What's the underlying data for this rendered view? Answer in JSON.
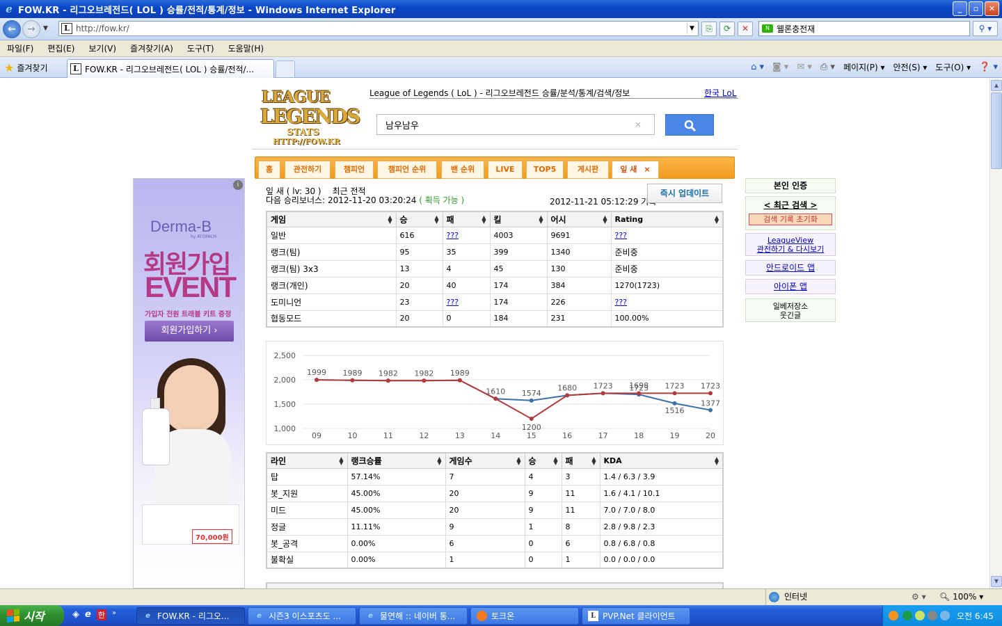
{
  "window": {
    "title": "FOW.KR - 리그오브레전드( LOL ) 승률/전적/통계/정보 - Windows Internet Explorer",
    "url": "http://fow.kr/",
    "search_value": "웰론충전재",
    "buttons": {
      "min": "_",
      "max": "▫",
      "close": "✕"
    }
  },
  "menu": [
    "파일(F)",
    "편집(E)",
    "보기(V)",
    "즐겨찾기(A)",
    "도구(T)",
    "도움말(H)"
  ],
  "tabs": {
    "favorites_label": "즐겨찾기",
    "active_tab": "FOW.KR - 리그오브레전드( LOL ) 승률/전적/...",
    "cmd": [
      "페이지(P) ▾",
      "안전(S) ▾",
      "도구(O) ▾"
    ]
  },
  "site": {
    "logo": {
      "line1": "LEAGUE",
      "line2": "LEGENDS",
      "of": "of",
      "line3": "STATS",
      "line4": "HTTP://FOW.KR"
    },
    "description": "League of Legends ( LoL ) - 리그오브레전드 승률/분석/통계/검색/정보",
    "korea_link": "한국 LoL",
    "search_value": "남우남우",
    "clear": "×",
    "nav": [
      {
        "label": "홈",
        "active": false
      },
      {
        "label": "관전하기",
        "active": false
      },
      {
        "label": "챔피언",
        "active": false
      },
      {
        "label": "챔피언 순위",
        "active": false
      },
      {
        "label": "밴 순위",
        "active": false
      },
      {
        "label": "LIVE",
        "active": false
      },
      {
        "label": "TOP5",
        "active": false
      },
      {
        "label": "게시판",
        "active": false
      },
      {
        "label": "잎 새",
        "active": true,
        "close": "×"
      }
    ]
  },
  "ad": {
    "info": "i",
    "brand": "Derma-B",
    "by": "by ATOPALM",
    "headline1": "회원가입",
    "headline2": "EVENT",
    "sub": "가입자 전원 트래블 키트 증정",
    "cta": "회원가입하기  ›",
    "price": "70,000원"
  },
  "sidebar": {
    "verify": "본인 인증",
    "recent": "< 최근 검색 >",
    "reset": "검색 기록 초기화",
    "leagueview_1": "LeagueView",
    "leagueview_2": "관전하기 & 다시보기",
    "android": "안드로이드 앱",
    "iphone": "아이폰 앱",
    "misc_1": "일베저장소",
    "misc_2": "웃긴글"
  },
  "summoner": {
    "name_line": "잎 새 ( lv: 30 )",
    "recent_label": "최근 전적",
    "bonus_label": "다음 승리보너스: 2012-11-20 03:20:24",
    "bonus_status": "( 획득 가능 )",
    "record_time": "2012-11-21 05:12:29 기록",
    "update_button": "즉시 업데이트"
  },
  "games_table": {
    "headers": [
      "게임",
      "승",
      "패",
      "킬",
      "어시",
      "Rating"
    ],
    "rows": [
      [
        "일반",
        "616",
        "???",
        "4003",
        "9691",
        "???"
      ],
      [
        "랭크(팀)",
        "95",
        "35",
        "399",
        "1340",
        "준비중"
      ],
      [
        "랭크(팀) 3x3",
        "13",
        "4",
        "45",
        "130",
        "준비중"
      ],
      [
        "랭크(개인)",
        "20",
        "40",
        "174",
        "384",
        "1270(1723)"
      ],
      [
        "도미니언",
        "23",
        "???",
        "174",
        "226",
        "???"
      ],
      [
        "협동모드",
        "20",
        "0",
        "184",
        "231",
        "100.00%"
      ]
    ]
  },
  "chart_data": {
    "type": "line",
    "x": [
      "09",
      "10",
      "11",
      "12",
      "13",
      "14",
      "15",
      "16",
      "17",
      "18",
      "19",
      "20"
    ],
    "ylim": [
      1000,
      2500
    ],
    "yticks": [
      "1,000",
      "1,500",
      "2,000",
      "2,500"
    ],
    "grid": true,
    "series": [
      {
        "color": "#b23a3a",
        "values": [
          1999,
          1989,
          1982,
          1982,
          1989,
          1610,
          1200,
          1680,
          1723,
          1723,
          1723,
          1723
        ],
        "labels": [
          "1999",
          "1989",
          "1982",
          "1982",
          "1989",
          "1610",
          "1200",
          "1680",
          "1723",
          "1723",
          "1723",
          "1723"
        ]
      },
      {
        "color": "#3b6fa8",
        "values": [
          1999,
          1989,
          1982,
          1982,
          1989,
          1610,
          1574,
          1680,
          1723,
          1698,
          1516,
          1377
        ],
        "labels": [
          "",
          "",
          "",
          "",
          "",
          "",
          "1574",
          "",
          "",
          "1698",
          "1516",
          "1377"
        ]
      }
    ]
  },
  "lane_table": {
    "headers": [
      "라인",
      "랭크승률",
      "게임수",
      "승",
      "패",
      "KDA"
    ],
    "rows": [
      [
        "탑",
        "57.14%",
        "7",
        "4",
        "3",
        "1.4 / 6.3 / 3.9"
      ],
      [
        "봇_지원",
        "45.00%",
        "20",
        "9",
        "11",
        "1.6 / 4.1 / 10.1"
      ],
      [
        "미드",
        "45.00%",
        "20",
        "9",
        "11",
        "7.0 / 7.0 / 8.0"
      ],
      [
        "정글",
        "11.11%",
        "9",
        "1",
        "8",
        "2.8 / 9.8 / 2.3"
      ],
      [
        "봇_공격",
        "0.00%",
        "6",
        "0",
        "6",
        "0.8 / 6.8 / 0.8"
      ],
      [
        "불확실",
        "0.00%",
        "1",
        "0",
        "1",
        "0.0 / 0.0 / 0.0"
      ]
    ]
  },
  "status": {
    "zone": "인터넷",
    "zoom": "100%"
  },
  "taskbar": {
    "start": "시작",
    "quick": [
      "e",
      "한"
    ],
    "tasks": [
      {
        "label": "FOW.KR - 리그오...",
        "active": true
      },
      {
        "label": "시즌3 이스포츠도 ...",
        "active": false
      },
      {
        "label": "물연해 :: 네이버 통...",
        "active": false
      },
      {
        "label": "토크온",
        "active": false
      },
      {
        "label": "PVP.Net 클라이언트",
        "active": false
      }
    ],
    "clock": "오전 6:45"
  }
}
